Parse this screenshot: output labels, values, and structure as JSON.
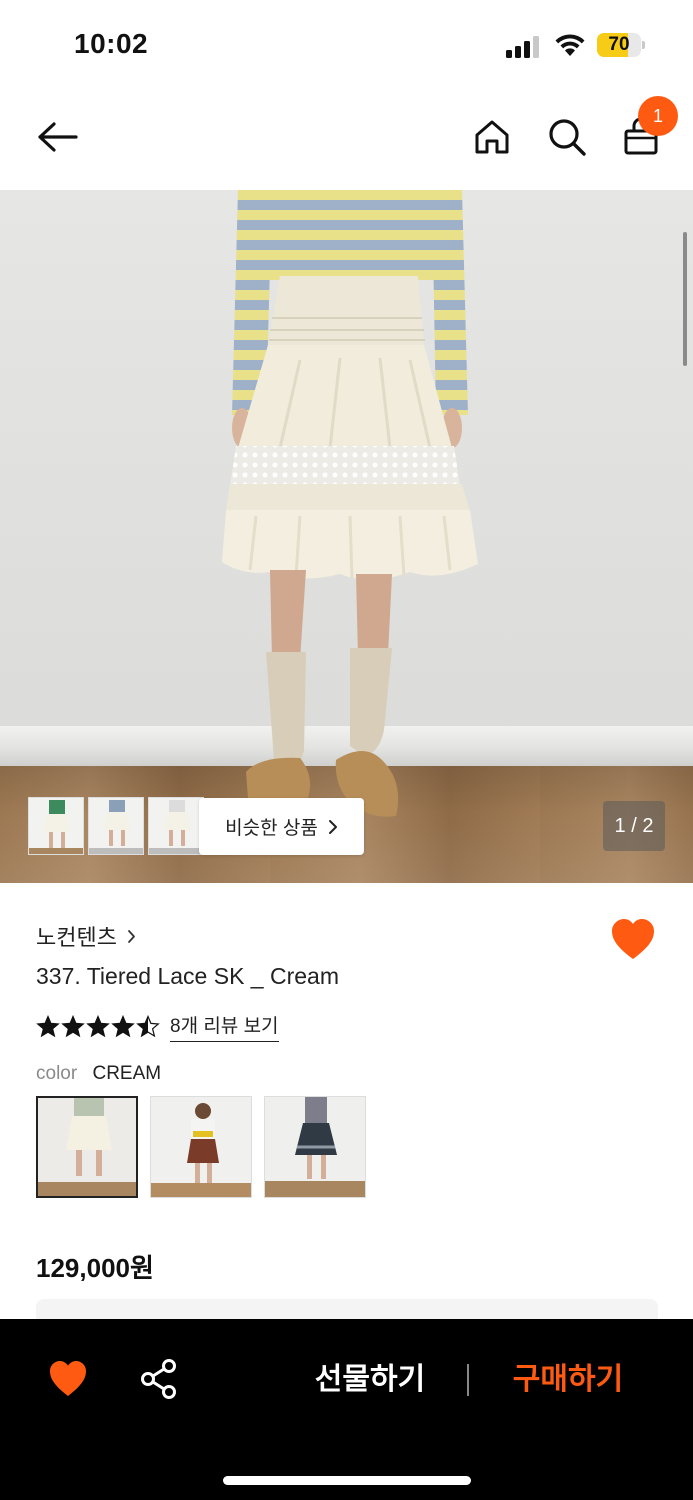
{
  "status_bar": {
    "time": "10:02",
    "battery_level": "70",
    "battery_fraction": 0.7
  },
  "nav": {
    "cart_count": "1",
    "icons": [
      "back-arrow-icon",
      "home-icon",
      "search-icon",
      "shopping-bag-icon"
    ]
  },
  "gallery": {
    "similar_label": "비슷한 상품",
    "page_indicator": "1 / 2",
    "thumbnail_count": 3
  },
  "product": {
    "brand": "노컨텐츠",
    "name": "337. Tiered Lace SK _ Cream",
    "rating": 4.5,
    "review_link": "8개 리뷰 보기",
    "color_label": "color",
    "color_value": "CREAM",
    "color_options": [
      "cream",
      "brown-plaid",
      "navy-tiered"
    ],
    "selected_color_index": 0,
    "price": "129,000원",
    "wishlisted": true
  },
  "bottom_bar": {
    "gift_label": "선물하기",
    "buy_label": "구매하기"
  },
  "colors": {
    "accent": "#ff5a12",
    "bottom_bar_bg": "#000000",
    "badge_bg": "#ff5a12",
    "battery_fill": "#f6cc16"
  }
}
